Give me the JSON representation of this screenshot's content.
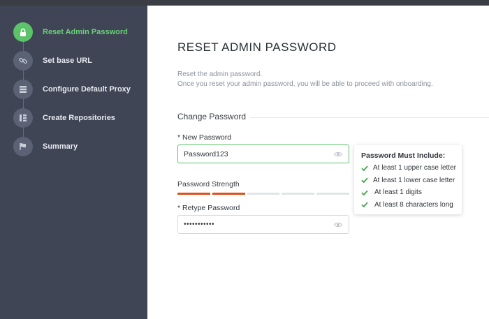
{
  "sidebar": {
    "steps": [
      {
        "label": "Reset Admin Password",
        "icon": "lock-icon",
        "active": true
      },
      {
        "label": "Set base URL",
        "icon": "link-icon",
        "active": false
      },
      {
        "label": "Configure Default Proxy",
        "icon": "server-icon",
        "active": false
      },
      {
        "label": "Create Repositories",
        "icon": "repository-tree-icon",
        "active": false
      },
      {
        "label": "Summary",
        "icon": "flag-icon",
        "active": false
      }
    ]
  },
  "main": {
    "title": "RESET ADMIN PASSWORD",
    "description_line1": "Reset the admin password.",
    "description_line2": "Once you reset your admin password, you will be able to proceed with onboarding.",
    "section_title": "Change Password",
    "new_password": {
      "label": "* New Password",
      "value": "Password123"
    },
    "strength": {
      "label": "Password Strength",
      "segments_total": 5,
      "segments_filled": 2
    },
    "retype_password": {
      "label": "* Retype Password",
      "value": "•••••••••••"
    }
  },
  "popover": {
    "title": "Password Must Include:",
    "rules": [
      "At least 1 upper case letter",
      "At least 1 lower case letter",
      "At least 1 digits",
      "At least 8 characters long"
    ]
  },
  "colors": {
    "sidebar_bg": "#3f4555",
    "active_green": "#5cc36a",
    "strength_red": "#e04f1a"
  }
}
